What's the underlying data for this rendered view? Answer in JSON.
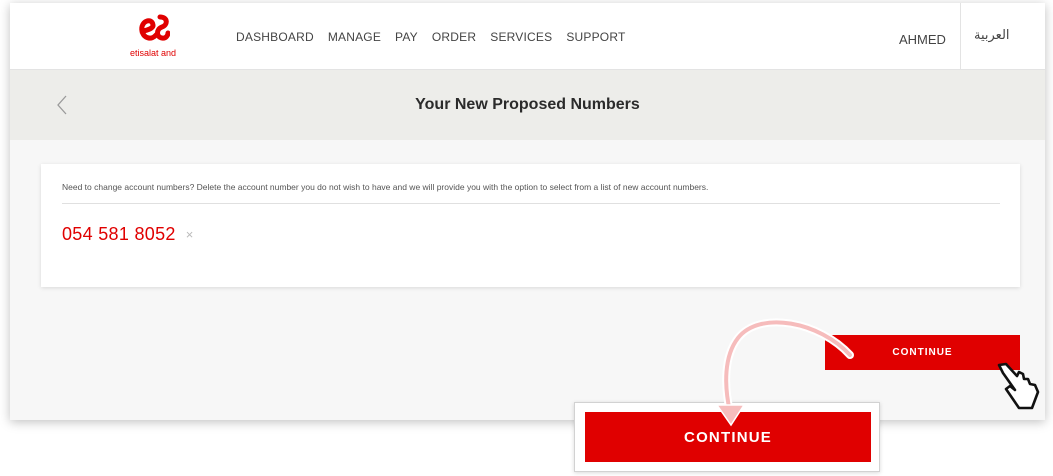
{
  "brand": {
    "logo_label": "etisalat and",
    "accent_color": "#e00000"
  },
  "nav": {
    "items": [
      {
        "label": "DASHBOARD"
      },
      {
        "label": "MANAGE"
      },
      {
        "label": "PAY"
      },
      {
        "label": "ORDER"
      },
      {
        "label": "SERVICES"
      },
      {
        "label": "SUPPORT"
      }
    ],
    "user_name": "AHMED",
    "language_switch": "العربية"
  },
  "page": {
    "title": "Your New Proposed Numbers",
    "back_icon": "chevron-left-icon"
  },
  "card": {
    "info_text": "Need to change account numbers? Delete the account number you do not wish to have and we will provide you with the option to select from a list of new account numbers.",
    "account_number": "054 581 8052",
    "remove_symbol": "×"
  },
  "actions": {
    "continue_label": "CONTINUE",
    "zoomed_continue_label": "CONTINUE"
  },
  "annotations": {
    "cursor_icon": "hand-pointer-icon",
    "arrow_icon": "curved-arrow-icon"
  }
}
